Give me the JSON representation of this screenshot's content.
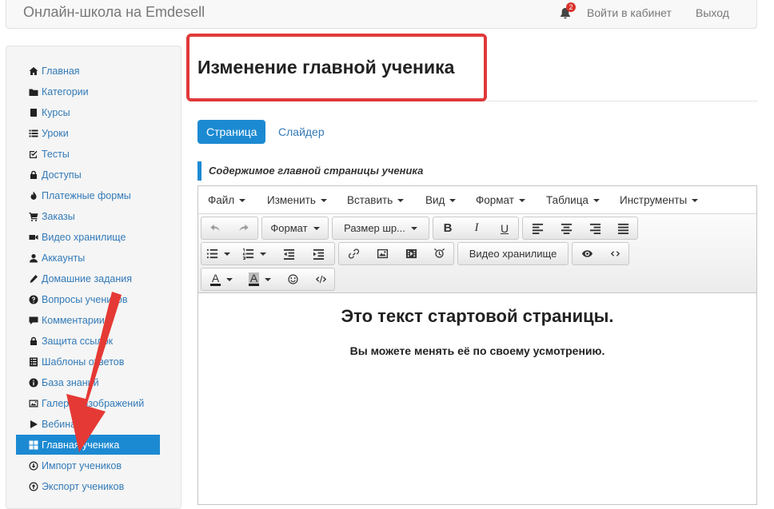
{
  "navbar": {
    "brand": "Онлайн-школа на Emdesell",
    "notifications_count": "2",
    "login_link": "Войти в кабинет",
    "logout_link": "Выход"
  },
  "sidebar": {
    "items": [
      {
        "label": "Главная",
        "icon": "home-icon"
      },
      {
        "label": "Категории",
        "icon": "folder-icon"
      },
      {
        "label": "Курсы",
        "icon": "book-icon"
      },
      {
        "label": "Уроки",
        "icon": "list-icon"
      },
      {
        "label": "Тесты",
        "icon": "edit-check-icon"
      },
      {
        "label": "Доступы",
        "icon": "lock-icon"
      },
      {
        "label": "Платежные формы",
        "icon": "fire-icon"
      },
      {
        "label": "Заказы",
        "icon": "cart-icon"
      },
      {
        "label": "Видео хранилище",
        "icon": "video-camera-icon"
      },
      {
        "label": "Аккаунты",
        "icon": "user-icon"
      },
      {
        "label": "Домашние задания",
        "icon": "pencil-icon"
      },
      {
        "label": "Вопросы учеников",
        "icon": "question-icon"
      },
      {
        "label": "Комментарии",
        "icon": "comment-icon"
      },
      {
        "label": "Защита ссылок",
        "icon": "lock-icon"
      },
      {
        "label": "Шаблоны ответов",
        "icon": "template-list-icon"
      },
      {
        "label": "База знаний",
        "icon": "info-icon"
      },
      {
        "label": "Галерея изображений",
        "icon": "picture-icon"
      },
      {
        "label": "Вебинары",
        "icon": "play-icon"
      },
      {
        "label": "Главная ученика",
        "icon": "grid-icon",
        "active": true
      },
      {
        "label": "Импорт учеников",
        "icon": "import-icon"
      },
      {
        "label": "Экспорт учеников",
        "icon": "export-icon"
      }
    ]
  },
  "page": {
    "title": "Изменение главной ученика",
    "tabs": [
      {
        "label": "Страница",
        "active": true
      },
      {
        "label": "Слайдер",
        "active": false
      }
    ],
    "section_label": "Содержимое главной страницы ученика"
  },
  "editor": {
    "menu": [
      "Файл",
      "Изменить",
      "Вставить",
      "Вид",
      "Формат",
      "Таблица",
      "Инструменты"
    ],
    "toolbar": {
      "format_dropdown": "Формат",
      "size_dropdown": "Размер шр...",
      "video_storage_button": "Видео хранилище"
    },
    "content": {
      "heading": "Это текст стартовой страницы.",
      "paragraph": "Вы можете менять её по своему усмотрению."
    }
  },
  "colors": {
    "accent": "#1c8ad2",
    "highlight_box": "#e0393a",
    "arrow": "#e53935"
  }
}
